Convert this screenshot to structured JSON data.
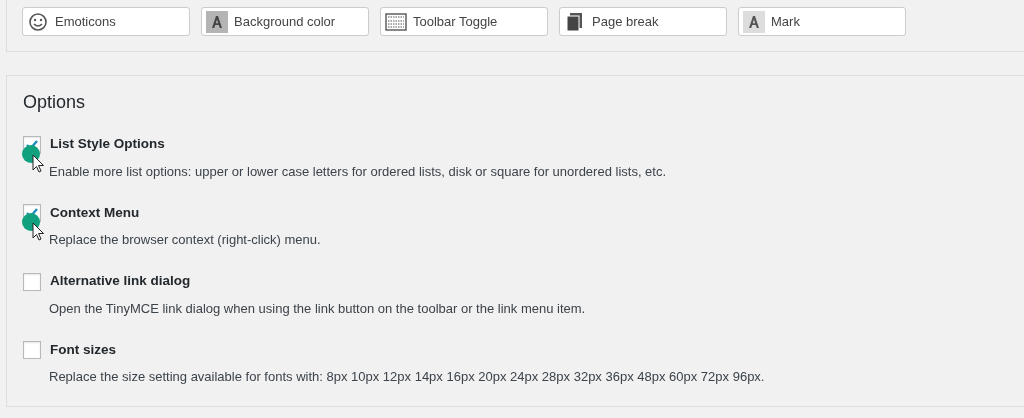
{
  "toolbar_buttons": [
    {
      "label": "Emoticons",
      "kind": "smiley"
    },
    {
      "label": "Background color",
      "kind": "letter-shaded"
    },
    {
      "label": "Toolbar Toggle",
      "kind": "keyboard"
    },
    {
      "label": "Page break",
      "kind": "pages"
    },
    {
      "label": "Mark",
      "kind": "letter-light"
    }
  ],
  "options": {
    "title": "Options",
    "items": [
      {
        "label": "List Style Options",
        "description": "Enable more list options: upper or lower case letters for ordered lists, disk or square for unordered lists, etc.",
        "checked": true,
        "pointer": true
      },
      {
        "label": "Context Menu",
        "description": "Replace the browser context (right-click) menu.",
        "checked": true,
        "pointer": true
      },
      {
        "label": "Alternative link dialog",
        "description": "Open the TinyMCE link dialog when using the link button on the toolbar or the link menu item.",
        "checked": false,
        "pointer": false
      },
      {
        "label": "Font sizes",
        "description": "Replace the size setting available for fonts with: 8px 10px 12px 14px 16px 20px 24px 28px 32px 36px 48px 60px 72px 96px.",
        "checked": false,
        "pointer": false
      }
    ]
  }
}
